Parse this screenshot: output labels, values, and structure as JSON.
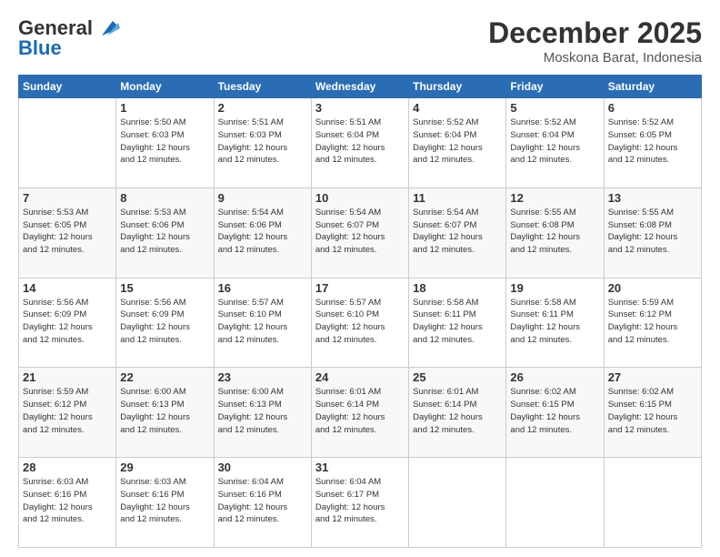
{
  "logo": {
    "general": "General",
    "blue": "Blue"
  },
  "title": "December 2025",
  "location": "Moskona Barat, Indonesia",
  "days_header": [
    "Sunday",
    "Monday",
    "Tuesday",
    "Wednesday",
    "Thursday",
    "Friday",
    "Saturday"
  ],
  "weeks": [
    [
      {
        "num": "",
        "info": ""
      },
      {
        "num": "1",
        "info": "Sunrise: 5:50 AM\nSunset: 6:03 PM\nDaylight: 12 hours\nand 12 minutes."
      },
      {
        "num": "2",
        "info": "Sunrise: 5:51 AM\nSunset: 6:03 PM\nDaylight: 12 hours\nand 12 minutes."
      },
      {
        "num": "3",
        "info": "Sunrise: 5:51 AM\nSunset: 6:04 PM\nDaylight: 12 hours\nand 12 minutes."
      },
      {
        "num": "4",
        "info": "Sunrise: 5:52 AM\nSunset: 6:04 PM\nDaylight: 12 hours\nand 12 minutes."
      },
      {
        "num": "5",
        "info": "Sunrise: 5:52 AM\nSunset: 6:04 PM\nDaylight: 12 hours\nand 12 minutes."
      },
      {
        "num": "6",
        "info": "Sunrise: 5:52 AM\nSunset: 6:05 PM\nDaylight: 12 hours\nand 12 minutes."
      }
    ],
    [
      {
        "num": "7",
        "info": "Sunrise: 5:53 AM\nSunset: 6:05 PM\nDaylight: 12 hours\nand 12 minutes."
      },
      {
        "num": "8",
        "info": "Sunrise: 5:53 AM\nSunset: 6:06 PM\nDaylight: 12 hours\nand 12 minutes."
      },
      {
        "num": "9",
        "info": "Sunrise: 5:54 AM\nSunset: 6:06 PM\nDaylight: 12 hours\nand 12 minutes."
      },
      {
        "num": "10",
        "info": "Sunrise: 5:54 AM\nSunset: 6:07 PM\nDaylight: 12 hours\nand 12 minutes."
      },
      {
        "num": "11",
        "info": "Sunrise: 5:54 AM\nSunset: 6:07 PM\nDaylight: 12 hours\nand 12 minutes."
      },
      {
        "num": "12",
        "info": "Sunrise: 5:55 AM\nSunset: 6:08 PM\nDaylight: 12 hours\nand 12 minutes."
      },
      {
        "num": "13",
        "info": "Sunrise: 5:55 AM\nSunset: 6:08 PM\nDaylight: 12 hours\nand 12 minutes."
      }
    ],
    [
      {
        "num": "14",
        "info": "Sunrise: 5:56 AM\nSunset: 6:09 PM\nDaylight: 12 hours\nand 12 minutes."
      },
      {
        "num": "15",
        "info": "Sunrise: 5:56 AM\nSunset: 6:09 PM\nDaylight: 12 hours\nand 12 minutes."
      },
      {
        "num": "16",
        "info": "Sunrise: 5:57 AM\nSunset: 6:10 PM\nDaylight: 12 hours\nand 12 minutes."
      },
      {
        "num": "17",
        "info": "Sunrise: 5:57 AM\nSunset: 6:10 PM\nDaylight: 12 hours\nand 12 minutes."
      },
      {
        "num": "18",
        "info": "Sunrise: 5:58 AM\nSunset: 6:11 PM\nDaylight: 12 hours\nand 12 minutes."
      },
      {
        "num": "19",
        "info": "Sunrise: 5:58 AM\nSunset: 6:11 PM\nDaylight: 12 hours\nand 12 minutes."
      },
      {
        "num": "20",
        "info": "Sunrise: 5:59 AM\nSunset: 6:12 PM\nDaylight: 12 hours\nand 12 minutes."
      }
    ],
    [
      {
        "num": "21",
        "info": "Sunrise: 5:59 AM\nSunset: 6:12 PM\nDaylight: 12 hours\nand 12 minutes."
      },
      {
        "num": "22",
        "info": "Sunrise: 6:00 AM\nSunset: 6:13 PM\nDaylight: 12 hours\nand 12 minutes."
      },
      {
        "num": "23",
        "info": "Sunrise: 6:00 AM\nSunset: 6:13 PM\nDaylight: 12 hours\nand 12 minutes."
      },
      {
        "num": "24",
        "info": "Sunrise: 6:01 AM\nSunset: 6:14 PM\nDaylight: 12 hours\nand 12 minutes."
      },
      {
        "num": "25",
        "info": "Sunrise: 6:01 AM\nSunset: 6:14 PM\nDaylight: 12 hours\nand 12 minutes."
      },
      {
        "num": "26",
        "info": "Sunrise: 6:02 AM\nSunset: 6:15 PM\nDaylight: 12 hours\nand 12 minutes."
      },
      {
        "num": "27",
        "info": "Sunrise: 6:02 AM\nSunset: 6:15 PM\nDaylight: 12 hours\nand 12 minutes."
      }
    ],
    [
      {
        "num": "28",
        "info": "Sunrise: 6:03 AM\nSunset: 6:16 PM\nDaylight: 12 hours\nand 12 minutes."
      },
      {
        "num": "29",
        "info": "Sunrise: 6:03 AM\nSunset: 6:16 PM\nDaylight: 12 hours\nand 12 minutes."
      },
      {
        "num": "30",
        "info": "Sunrise: 6:04 AM\nSunset: 6:16 PM\nDaylight: 12 hours\nand 12 minutes."
      },
      {
        "num": "31",
        "info": "Sunrise: 6:04 AM\nSunset: 6:17 PM\nDaylight: 12 hours\nand 12 minutes."
      },
      {
        "num": "",
        "info": ""
      },
      {
        "num": "",
        "info": ""
      },
      {
        "num": "",
        "info": ""
      }
    ]
  ]
}
